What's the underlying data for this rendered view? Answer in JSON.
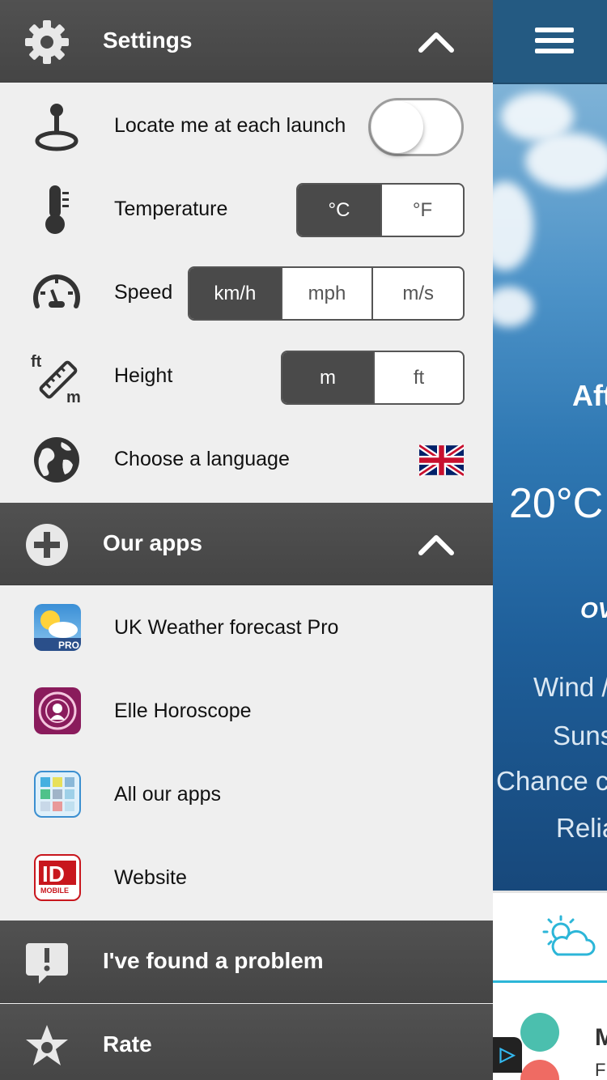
{
  "settings": {
    "header_label": "Settings",
    "locate": {
      "label": "Locate me at each launch",
      "enabled": false
    },
    "temperature": {
      "label": "Temperature",
      "options": [
        "°C",
        "°F"
      ],
      "selected": "°C"
    },
    "speed": {
      "label": "Speed",
      "options": [
        "km/h",
        "mph",
        "m/s"
      ],
      "selected": "km/h"
    },
    "height": {
      "label": "Height",
      "options": [
        "m",
        "ft"
      ],
      "selected": "m",
      "icon_label_top": "ft",
      "icon_label_bottom": "m"
    },
    "language": {
      "label": "Choose a language",
      "flag": "uk-flag"
    }
  },
  "our_apps": {
    "header_label": "Our apps",
    "items": [
      {
        "label": "UK Weather forecast Pro",
        "icon": "uk-weather-pro-app-icon",
        "badge": "PRO"
      },
      {
        "label": "Elle Horoscope",
        "icon": "elle-horoscope-app-icon"
      },
      {
        "label": "All our apps",
        "icon": "all-apps-grid-icon"
      },
      {
        "label": "Website",
        "icon": "id-mobile-logo",
        "logo_text": "ID",
        "logo_sub": "MOBILE"
      }
    ]
  },
  "problem": {
    "label": "I've found a problem"
  },
  "rate": {
    "label": "Rate"
  },
  "background": {
    "heading": "Aft",
    "temperature": "20°C",
    "condition": "OV",
    "wind": "Wind /",
    "sunset": "Suns",
    "chance": "Chance c",
    "reliability": "Relia",
    "list_title": "M",
    "list_sub": "F"
  },
  "colors": {
    "header_dark": "#4a4a4a",
    "drawer_bg": "#efefef",
    "topbar_blue": "#245a82",
    "accent_cyan": "#2cb6d8"
  }
}
